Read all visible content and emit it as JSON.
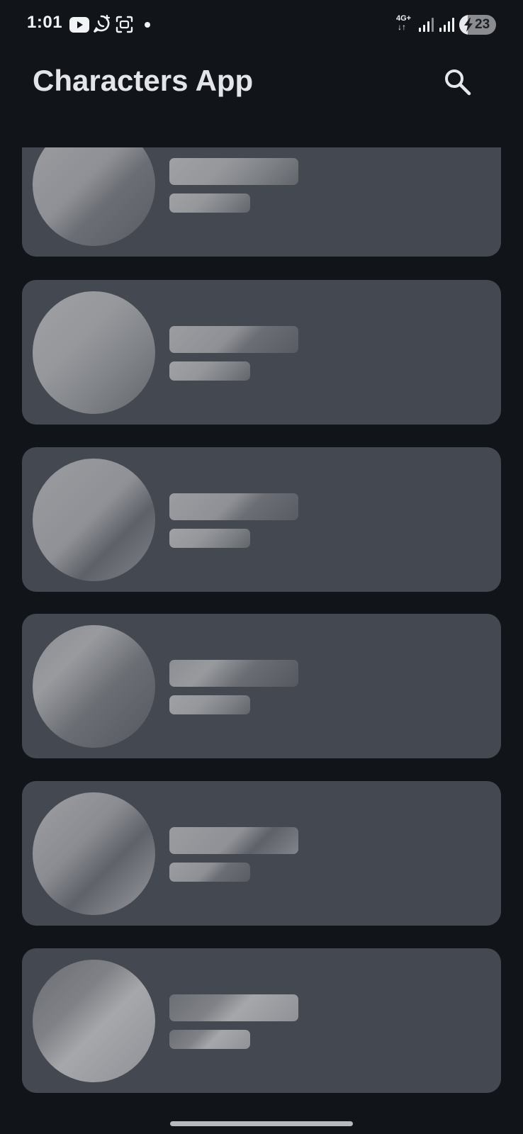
{
  "status_bar": {
    "time": "1:01",
    "network": "4G+",
    "network_arrows": "↓↑",
    "battery_level": "23",
    "battery_fraction": 0.23,
    "notification_icons": [
      "youtube-icon",
      "whatsapp-business-icon",
      "screenshot-icon"
    ],
    "charging": true
  },
  "app_bar": {
    "title": "Characters App",
    "search_icon": "search-icon"
  },
  "list": {
    "state": "loading",
    "skeleton_cards": [
      {
        "index": 1,
        "partially_scrolled": true
      },
      {
        "index": 2
      },
      {
        "index": 3
      },
      {
        "index": 4
      },
      {
        "index": 5
      },
      {
        "index": 6
      }
    ]
  },
  "colors": {
    "background": "#111419",
    "card": "#444850",
    "skeleton_light": "#9b9da1",
    "skeleton_dark": "#595c63",
    "title": "#e3e5e9"
  }
}
